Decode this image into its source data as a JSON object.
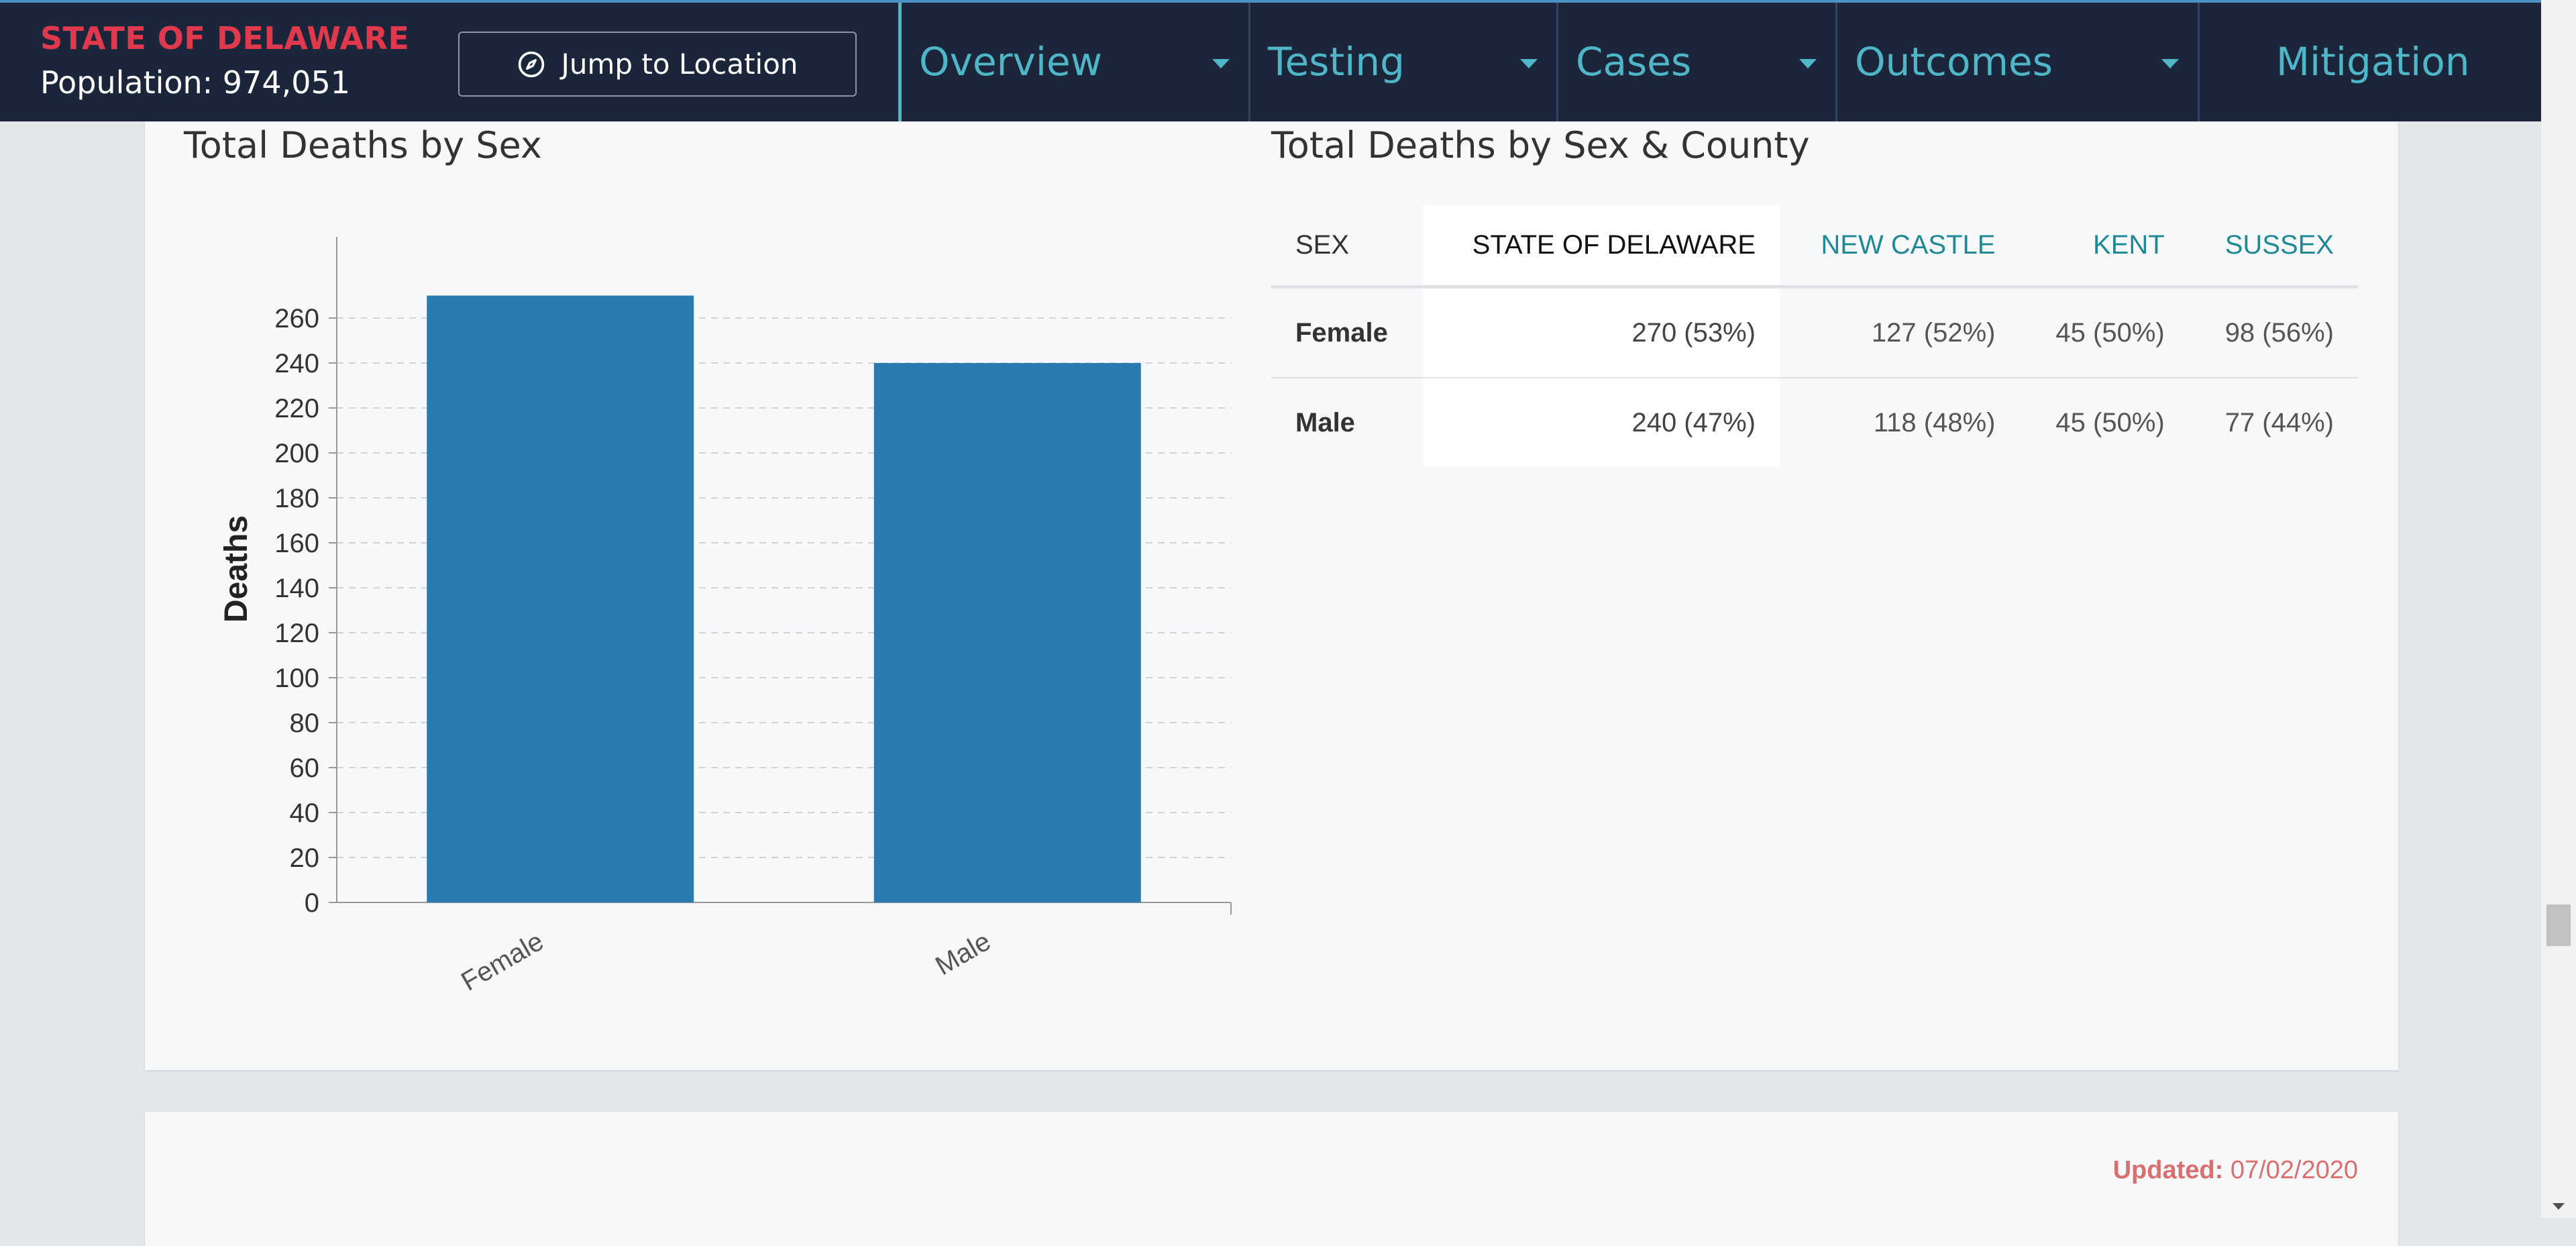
{
  "header": {
    "location_name": "STATE OF DELAWARE",
    "population": "Population: 974,051",
    "jump_label": "Jump to Location",
    "nav": [
      {
        "label": "Overview",
        "has_caret": true
      },
      {
        "label": "Testing",
        "has_caret": true
      },
      {
        "label": "Cases",
        "has_caret": true
      },
      {
        "label": "Outcomes",
        "has_caret": true
      },
      {
        "label": "Mitigation",
        "has_caret": false
      }
    ],
    "accent_color": "#4fb6c8",
    "brand_color": "#e0394d"
  },
  "deaths_by_sex": {
    "title": "Total Deaths by Sex"
  },
  "chart_data": {
    "type": "bar",
    "title": "Total Deaths by Sex",
    "categories": [
      "Female",
      "Male"
    ],
    "values": [
      270,
      240
    ],
    "xlabel": "",
    "ylabel": "Deaths",
    "ylim": [
      0,
      290
    ],
    "yticks": [
      0,
      20,
      40,
      60,
      80,
      100,
      120,
      140,
      160,
      180,
      200,
      220,
      240,
      260
    ],
    "grid": true,
    "bar_color": "#2b7bb3"
  },
  "deaths_by_sex_county": {
    "title": "Total Deaths by Sex & County",
    "columns": [
      "SEX",
      "STATE OF DELAWARE",
      "NEW CASTLE",
      "KENT",
      "SUSSEX"
    ],
    "rows": [
      {
        "sex": "Female",
        "state": "270 (53%)",
        "new_castle": "127 (52%)",
        "kent": "45 (50%)",
        "sussex": "98 (56%)"
      },
      {
        "sex": "Male",
        "state": "240 (47%)",
        "new_castle": "118 (48%)",
        "kent": "45 (50%)",
        "sussex": "77 (44%)"
      }
    ]
  },
  "next_section": {
    "updated_label": "Updated:",
    "updated_date": "07/02/2020"
  }
}
